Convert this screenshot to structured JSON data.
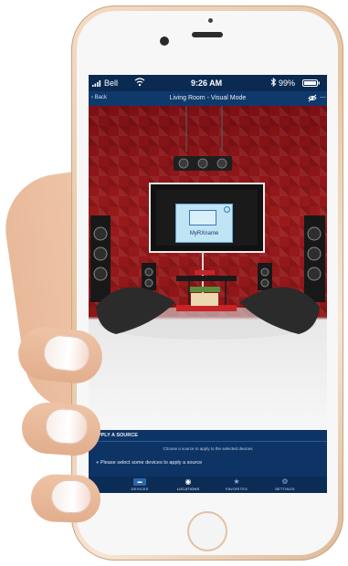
{
  "status_bar": {
    "carrier": "Bell",
    "time": "9:26 AM",
    "battery": "99%"
  },
  "nav_bar": {
    "back_label": "Back",
    "title": "Living Room - Visual Mode"
  },
  "scene": {
    "tv_label": "MyRXname"
  },
  "apply_source": {
    "header": "APPLY A SOURCE",
    "subtitle": "Choose a source to apply to the selected devices",
    "message": "Please select some devices to apply a source"
  },
  "tabbar": {
    "items": [
      {
        "label": "DEVICES",
        "icon": "devices-icon"
      },
      {
        "label": "LOCATIONS",
        "icon": "location-pin-icon"
      },
      {
        "label": "FAVORITES",
        "icon": "star-icon"
      },
      {
        "label": "SETTINGS",
        "icon": "gear-icon"
      }
    ],
    "active_index": 1
  },
  "colors": {
    "screen_bg": "#0c2f5a",
    "accent": "#7fb3ea",
    "wall_red": "#8d1618"
  }
}
